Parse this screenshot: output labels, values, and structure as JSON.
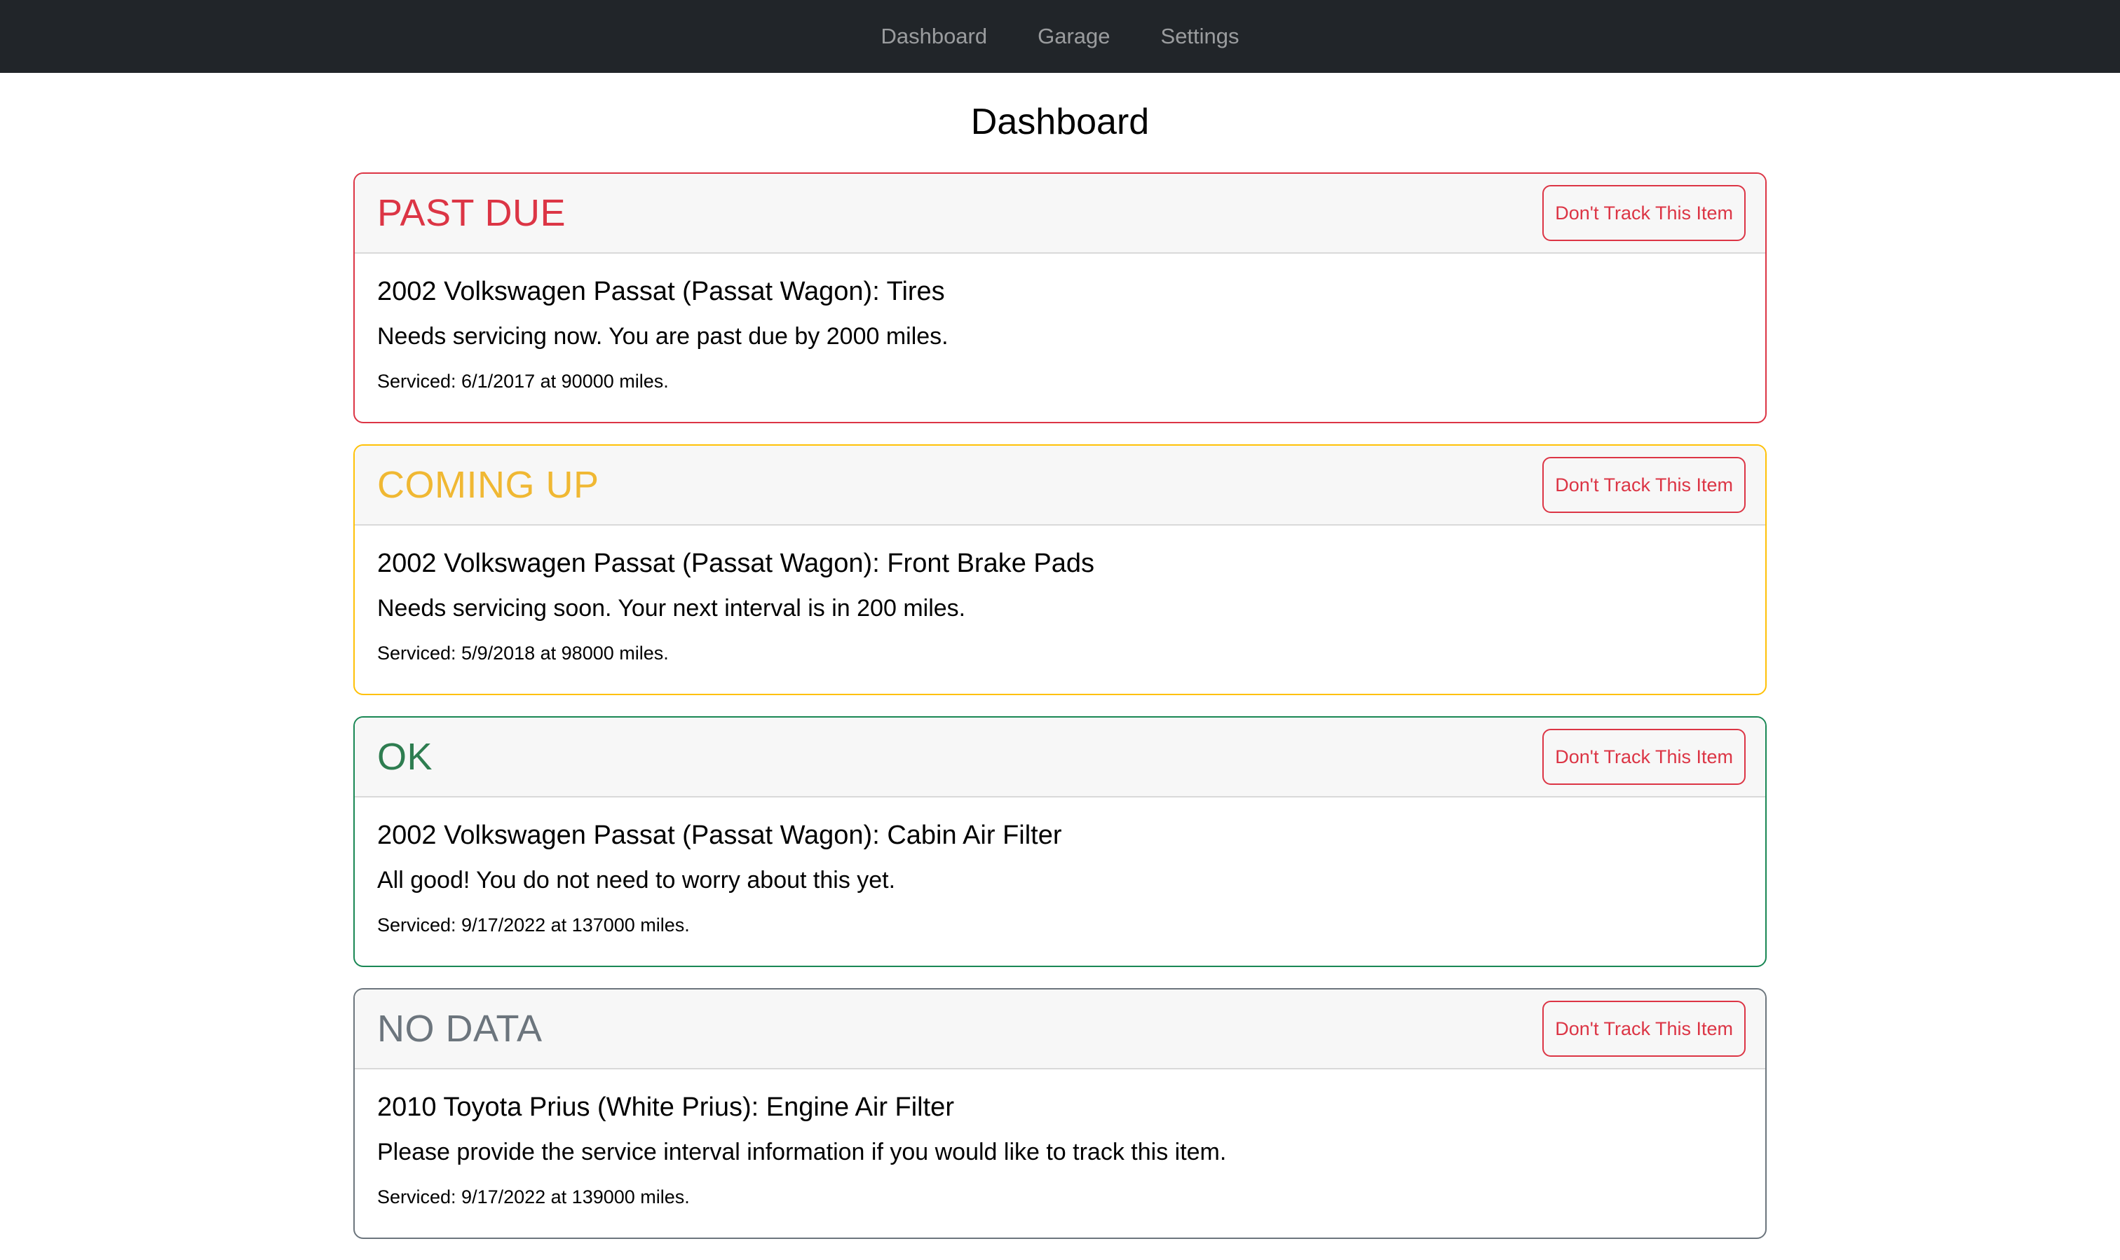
{
  "nav": {
    "items": [
      {
        "label": "Dashboard"
      },
      {
        "label": "Garage"
      },
      {
        "label": "Settings"
      }
    ]
  },
  "page": {
    "title": "Dashboard"
  },
  "colors": {
    "navbar_bg": "#212529",
    "past_due": "#dc3545",
    "coming_up": "#ffc107",
    "ok": "#198754",
    "no_data": "#6c757d"
  },
  "cards": [
    {
      "status": "PAST DUE",
      "button_label": "Don't Track This Item",
      "title": "2002 Volkswagen Passat (Passat Wagon): Tires",
      "text": "Needs servicing now. You are past due by 2000 miles.",
      "serviced": "Serviced: 6/1/2017 at 90000 miles."
    },
    {
      "status": "COMING UP",
      "button_label": "Don't Track This Item",
      "title": "2002 Volkswagen Passat (Passat Wagon): Front Brake Pads",
      "text": "Needs servicing soon. Your next interval is in 200 miles.",
      "serviced": "Serviced: 5/9/2018 at 98000 miles."
    },
    {
      "status": "OK",
      "button_label": "Don't Track This Item",
      "title": "2002 Volkswagen Passat (Passat Wagon): Cabin Air Filter",
      "text": "All good! You do not need to worry about this yet.",
      "serviced": "Serviced: 9/17/2022 at 137000 miles."
    },
    {
      "status": "NO DATA",
      "button_label": "Don't Track This Item",
      "title": "2010 Toyota Prius (White Prius): Engine Air Filter",
      "text": "Please provide the service interval information if you would like to track this item.",
      "serviced": "Serviced: 9/17/2022 at 139000 miles."
    }
  ]
}
